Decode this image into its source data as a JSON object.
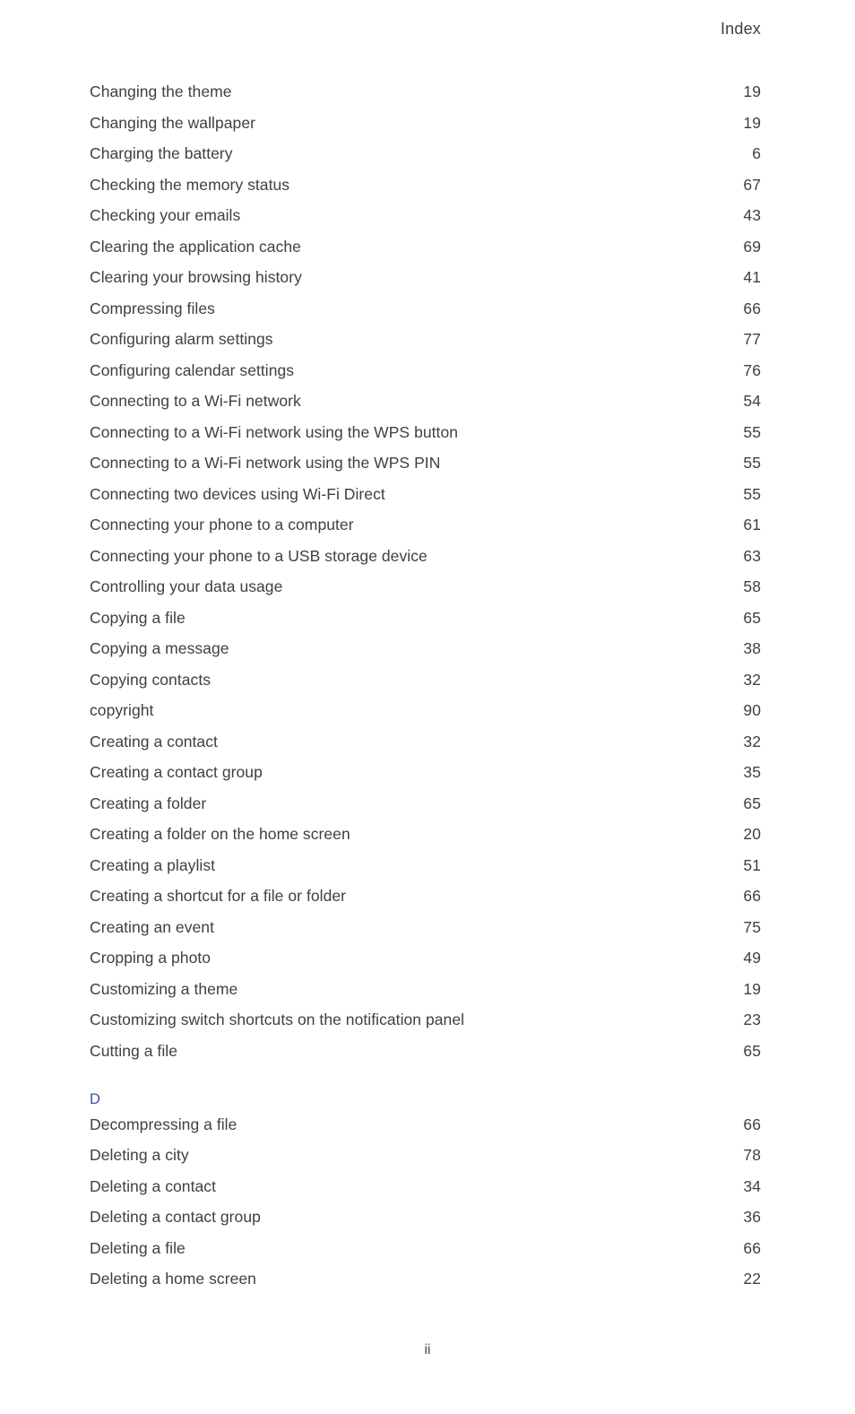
{
  "header": {
    "title": "Index"
  },
  "footer": {
    "page_number": "ii"
  },
  "colors": {
    "section_letter": "#3f51a5",
    "body_text": "#404040",
    "background": "#ffffff"
  },
  "sections": [
    {
      "letter": "",
      "show_letter": false,
      "entries": [
        {
          "title": "Changing the theme",
          "page": "19"
        },
        {
          "title": "Changing the wallpaper",
          "page": "19"
        },
        {
          "title": "Charging the battery",
          "page": "6"
        },
        {
          "title": "Checking the memory status",
          "page": "67"
        },
        {
          "title": "Checking your emails",
          "page": "43"
        },
        {
          "title": "Clearing the application cache",
          "page": "69"
        },
        {
          "title": "Clearing your browsing history",
          "page": "41"
        },
        {
          "title": "Compressing files",
          "page": "66"
        },
        {
          "title": "Configuring alarm settings",
          "page": "77"
        },
        {
          "title": "Configuring calendar settings",
          "page": "76"
        },
        {
          "title": "Connecting to a Wi-Fi network",
          "page": "54"
        },
        {
          "title": "Connecting to a Wi-Fi network using the WPS button",
          "page": "55"
        },
        {
          "title": "Connecting to a Wi-Fi network using the WPS PIN",
          "page": "55"
        },
        {
          "title": "Connecting two devices using Wi-Fi Direct",
          "page": "55"
        },
        {
          "title": "Connecting your phone to a computer",
          "page": "61"
        },
        {
          "title": "Connecting your phone to a USB storage device",
          "page": "63"
        },
        {
          "title": "Controlling your data usage",
          "page": "58"
        },
        {
          "title": "Copying a file",
          "page": "65"
        },
        {
          "title": "Copying a message",
          "page": "38"
        },
        {
          "title": "Copying contacts",
          "page": "32"
        },
        {
          "title": "copyright",
          "page": "90"
        },
        {
          "title": "Creating a contact",
          "page": "32"
        },
        {
          "title": "Creating a contact group",
          "page": "35"
        },
        {
          "title": "Creating a folder",
          "page": "65"
        },
        {
          "title": "Creating a folder on the home screen",
          "page": "20"
        },
        {
          "title": "Creating a playlist",
          "page": "51"
        },
        {
          "title": "Creating a shortcut for a file or folder",
          "page": "66"
        },
        {
          "title": "Creating an event",
          "page": "75"
        },
        {
          "title": "Cropping a photo",
          "page": "49"
        },
        {
          "title": "Customizing a theme",
          "page": "19"
        },
        {
          "title": "Customizing switch shortcuts on the notification panel",
          "page": "23"
        },
        {
          "title": "Cutting a file",
          "page": "65"
        }
      ]
    },
    {
      "letter": "D",
      "show_letter": true,
      "entries": [
        {
          "title": "Decompressing a file",
          "page": "66"
        },
        {
          "title": "Deleting a city",
          "page": "78"
        },
        {
          "title": "Deleting a contact",
          "page": "34"
        },
        {
          "title": "Deleting a contact group",
          "page": "36"
        },
        {
          "title": "Deleting a file",
          "page": "66"
        },
        {
          "title": "Deleting a home screen",
          "page": "22"
        }
      ]
    }
  ]
}
